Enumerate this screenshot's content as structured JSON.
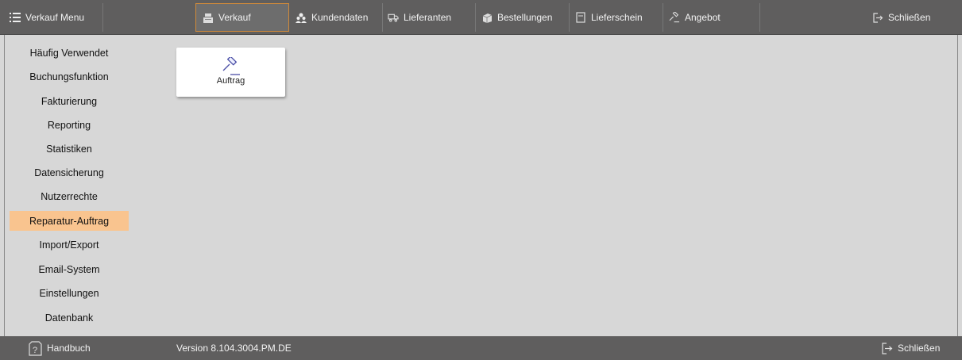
{
  "topbar": {
    "menu_label": "Verkauf Menu",
    "tabs": [
      {
        "label": "Verkauf",
        "icon": "cash-register-icon"
      },
      {
        "label": "Kundendaten",
        "icon": "users-icon"
      },
      {
        "label": "Lieferanten",
        "icon": "truck-icon"
      },
      {
        "label": "Bestellungen",
        "icon": "boxes-icon"
      },
      {
        "label": "Lieferschein",
        "icon": "document-icon"
      },
      {
        "label": "Angebot",
        "icon": "gavel-icon"
      }
    ],
    "close_label": "Schließen"
  },
  "sidebar": {
    "items": [
      {
        "label": "Häufig Verwendet"
      },
      {
        "label": "Buchungsfunktion"
      },
      {
        "label": "Fakturierung"
      },
      {
        "label": "Reporting"
      },
      {
        "label": "Statistiken"
      },
      {
        "label": "Datensicherung"
      },
      {
        "label": "Nutzerrechte"
      },
      {
        "label": "Reparatur-Auftrag"
      },
      {
        "label": "Import/Export"
      },
      {
        "label": "Email-System"
      },
      {
        "label": "Einstellungen"
      },
      {
        "label": "Datenbank"
      }
    ],
    "active_index": 7
  },
  "main": {
    "tiles": [
      {
        "label": "Auftrag",
        "icon": "gavel-icon"
      }
    ]
  },
  "footer": {
    "manual_label": "Handbuch",
    "version": "Version 8.104.3004.PM.DE",
    "close_label": "Schließen"
  },
  "colors": {
    "bar_bg": "#5f5e5e",
    "content_bg": "#d7d7d7",
    "active_item": "#f9c48f",
    "active_tab_border": "#d08a3a"
  }
}
